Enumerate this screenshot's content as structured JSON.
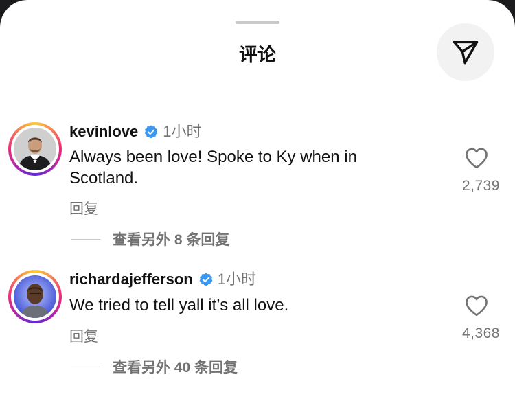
{
  "header": {
    "title": "评论",
    "share_icon": "send-icon"
  },
  "comments": [
    {
      "username": "kevinlove",
      "verified": true,
      "time": "1小时",
      "text_lines": [
        "Always been love! Spoke to Ky when in",
        "Scotland."
      ],
      "reply_label": "回复",
      "likes": "2,739",
      "view_more": "查看另外 8 条回复"
    },
    {
      "username": "richardajefferson",
      "verified": true,
      "time": "1小时",
      "text_lines": [
        "We tried to tell yall it’s all love."
      ],
      "reply_label": "回复",
      "likes": "4,368",
      "view_more": "查看另外 40 条回复"
    }
  ],
  "colors": {
    "verified_blue": "#3897f0",
    "secondary_text": "#737373",
    "primary_text": "#111111"
  }
}
